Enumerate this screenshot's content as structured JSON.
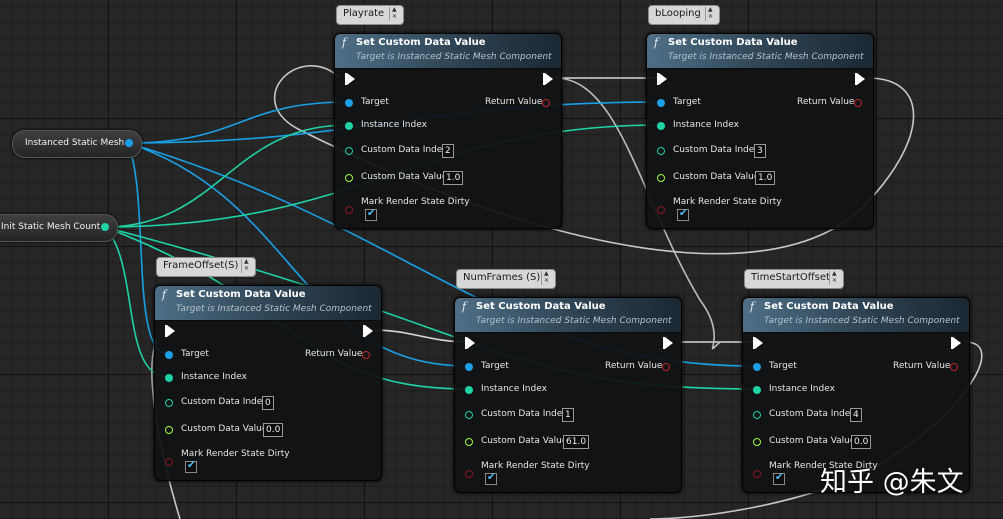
{
  "colors": {
    "object_pin": "#1aa0e6",
    "int_pin": "#1fd3a6",
    "float_pin": "#9fff44",
    "bool_pin": "#8c1a1a",
    "exec_pin": "#ffffff",
    "header": "#3c5a70"
  },
  "variables": {
    "mesh": {
      "label": "Instanced Static Mesh"
    },
    "count": {
      "label": "Init Static Mesh Count"
    }
  },
  "node_text": {
    "title": "Set Custom Data Value",
    "subtitle": "Target is Instanced Static Mesh Component",
    "target": "Target",
    "instance_index": "Instance Index",
    "custom_data_index": "Custom Data Index",
    "custom_data_value": "Custom Data Value",
    "mark_render_state_dirty": "Mark Render State Dirty",
    "return_value": "Return Value",
    "function_icon": "f"
  },
  "nodes": [
    {
      "comment": "Playrate",
      "custom_data_index": "2",
      "custom_data_value": "1.0",
      "mark_dirty": true
    },
    {
      "comment": "bLooping",
      "custom_data_index": "3",
      "custom_data_value": "1.0",
      "mark_dirty": true
    },
    {
      "comment": "FrameOffset(S)",
      "custom_data_index": "0",
      "custom_data_value": "0.0",
      "mark_dirty": true
    },
    {
      "comment": "NumFrames (S)",
      "custom_data_index": "1",
      "custom_data_value": "61.0",
      "mark_dirty": true
    },
    {
      "comment": "TimeStartOffset",
      "custom_data_index": "4",
      "custom_data_value": "0.0",
      "mark_dirty": true
    }
  ],
  "watermark": "知乎 @朱文"
}
